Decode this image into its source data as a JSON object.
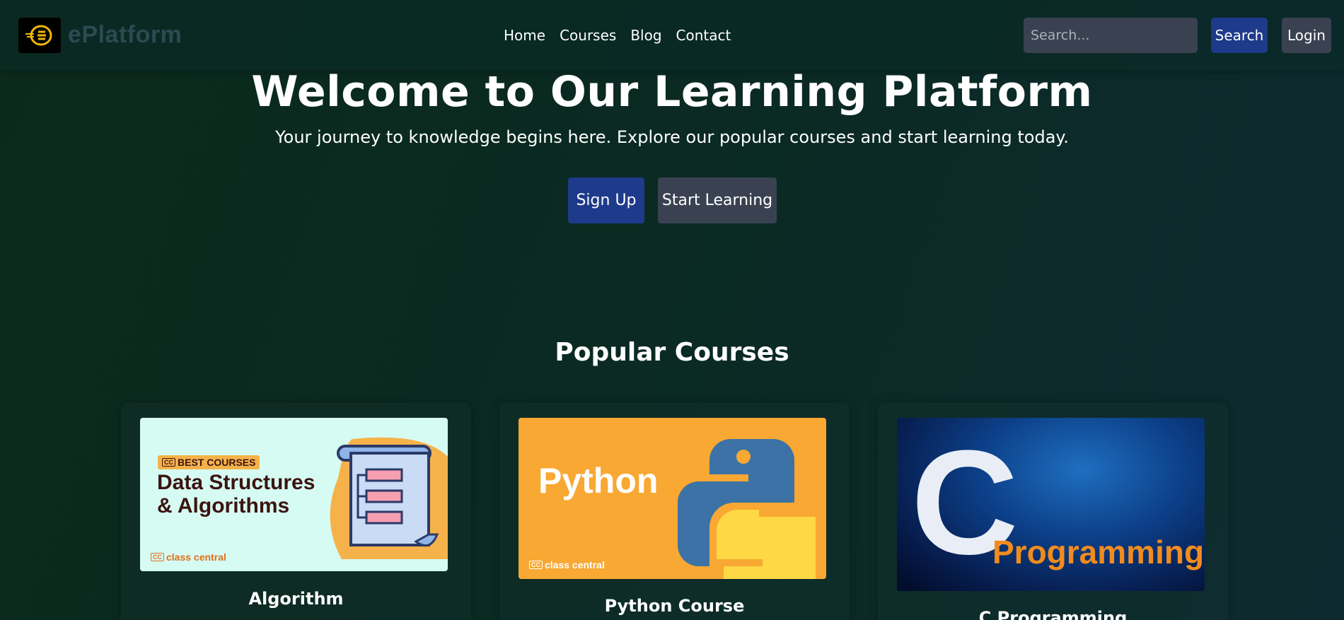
{
  "brand": {
    "name": "ePlatform",
    "logo_icon": "eplatform-logo-icon"
  },
  "nav": {
    "links": [
      {
        "label": "Home"
      },
      {
        "label": "Courses"
      },
      {
        "label": "Blog"
      },
      {
        "label": "Contact"
      }
    ],
    "search_placeholder": "Search...",
    "search_button": "Search",
    "login_button": "Login"
  },
  "hero": {
    "title": "Welcome to Our Learning Platform",
    "subtitle": "Your journey to knowledge begins here. Explore our popular courses and start learning today.",
    "signup_button": "Sign Up",
    "start_button": "Start Learning"
  },
  "popular": {
    "title": "Popular Courses",
    "courses": [
      {
        "title": "Algorithm",
        "image": {
          "badge": "BEST COURSES",
          "line1": "Data Structures",
          "line2": "& Algorithms",
          "provider": "class central"
        }
      },
      {
        "title": "Python Course",
        "image": {
          "text": "Python",
          "provider": "class central"
        }
      },
      {
        "title": "C Programming",
        "image": {
          "letter": "C",
          "word": "Programming"
        }
      }
    ]
  },
  "colors": {
    "primary_button": "#1e3a8a",
    "secondary_button": "#3a4252",
    "accent_orange": "#f08c1e"
  }
}
